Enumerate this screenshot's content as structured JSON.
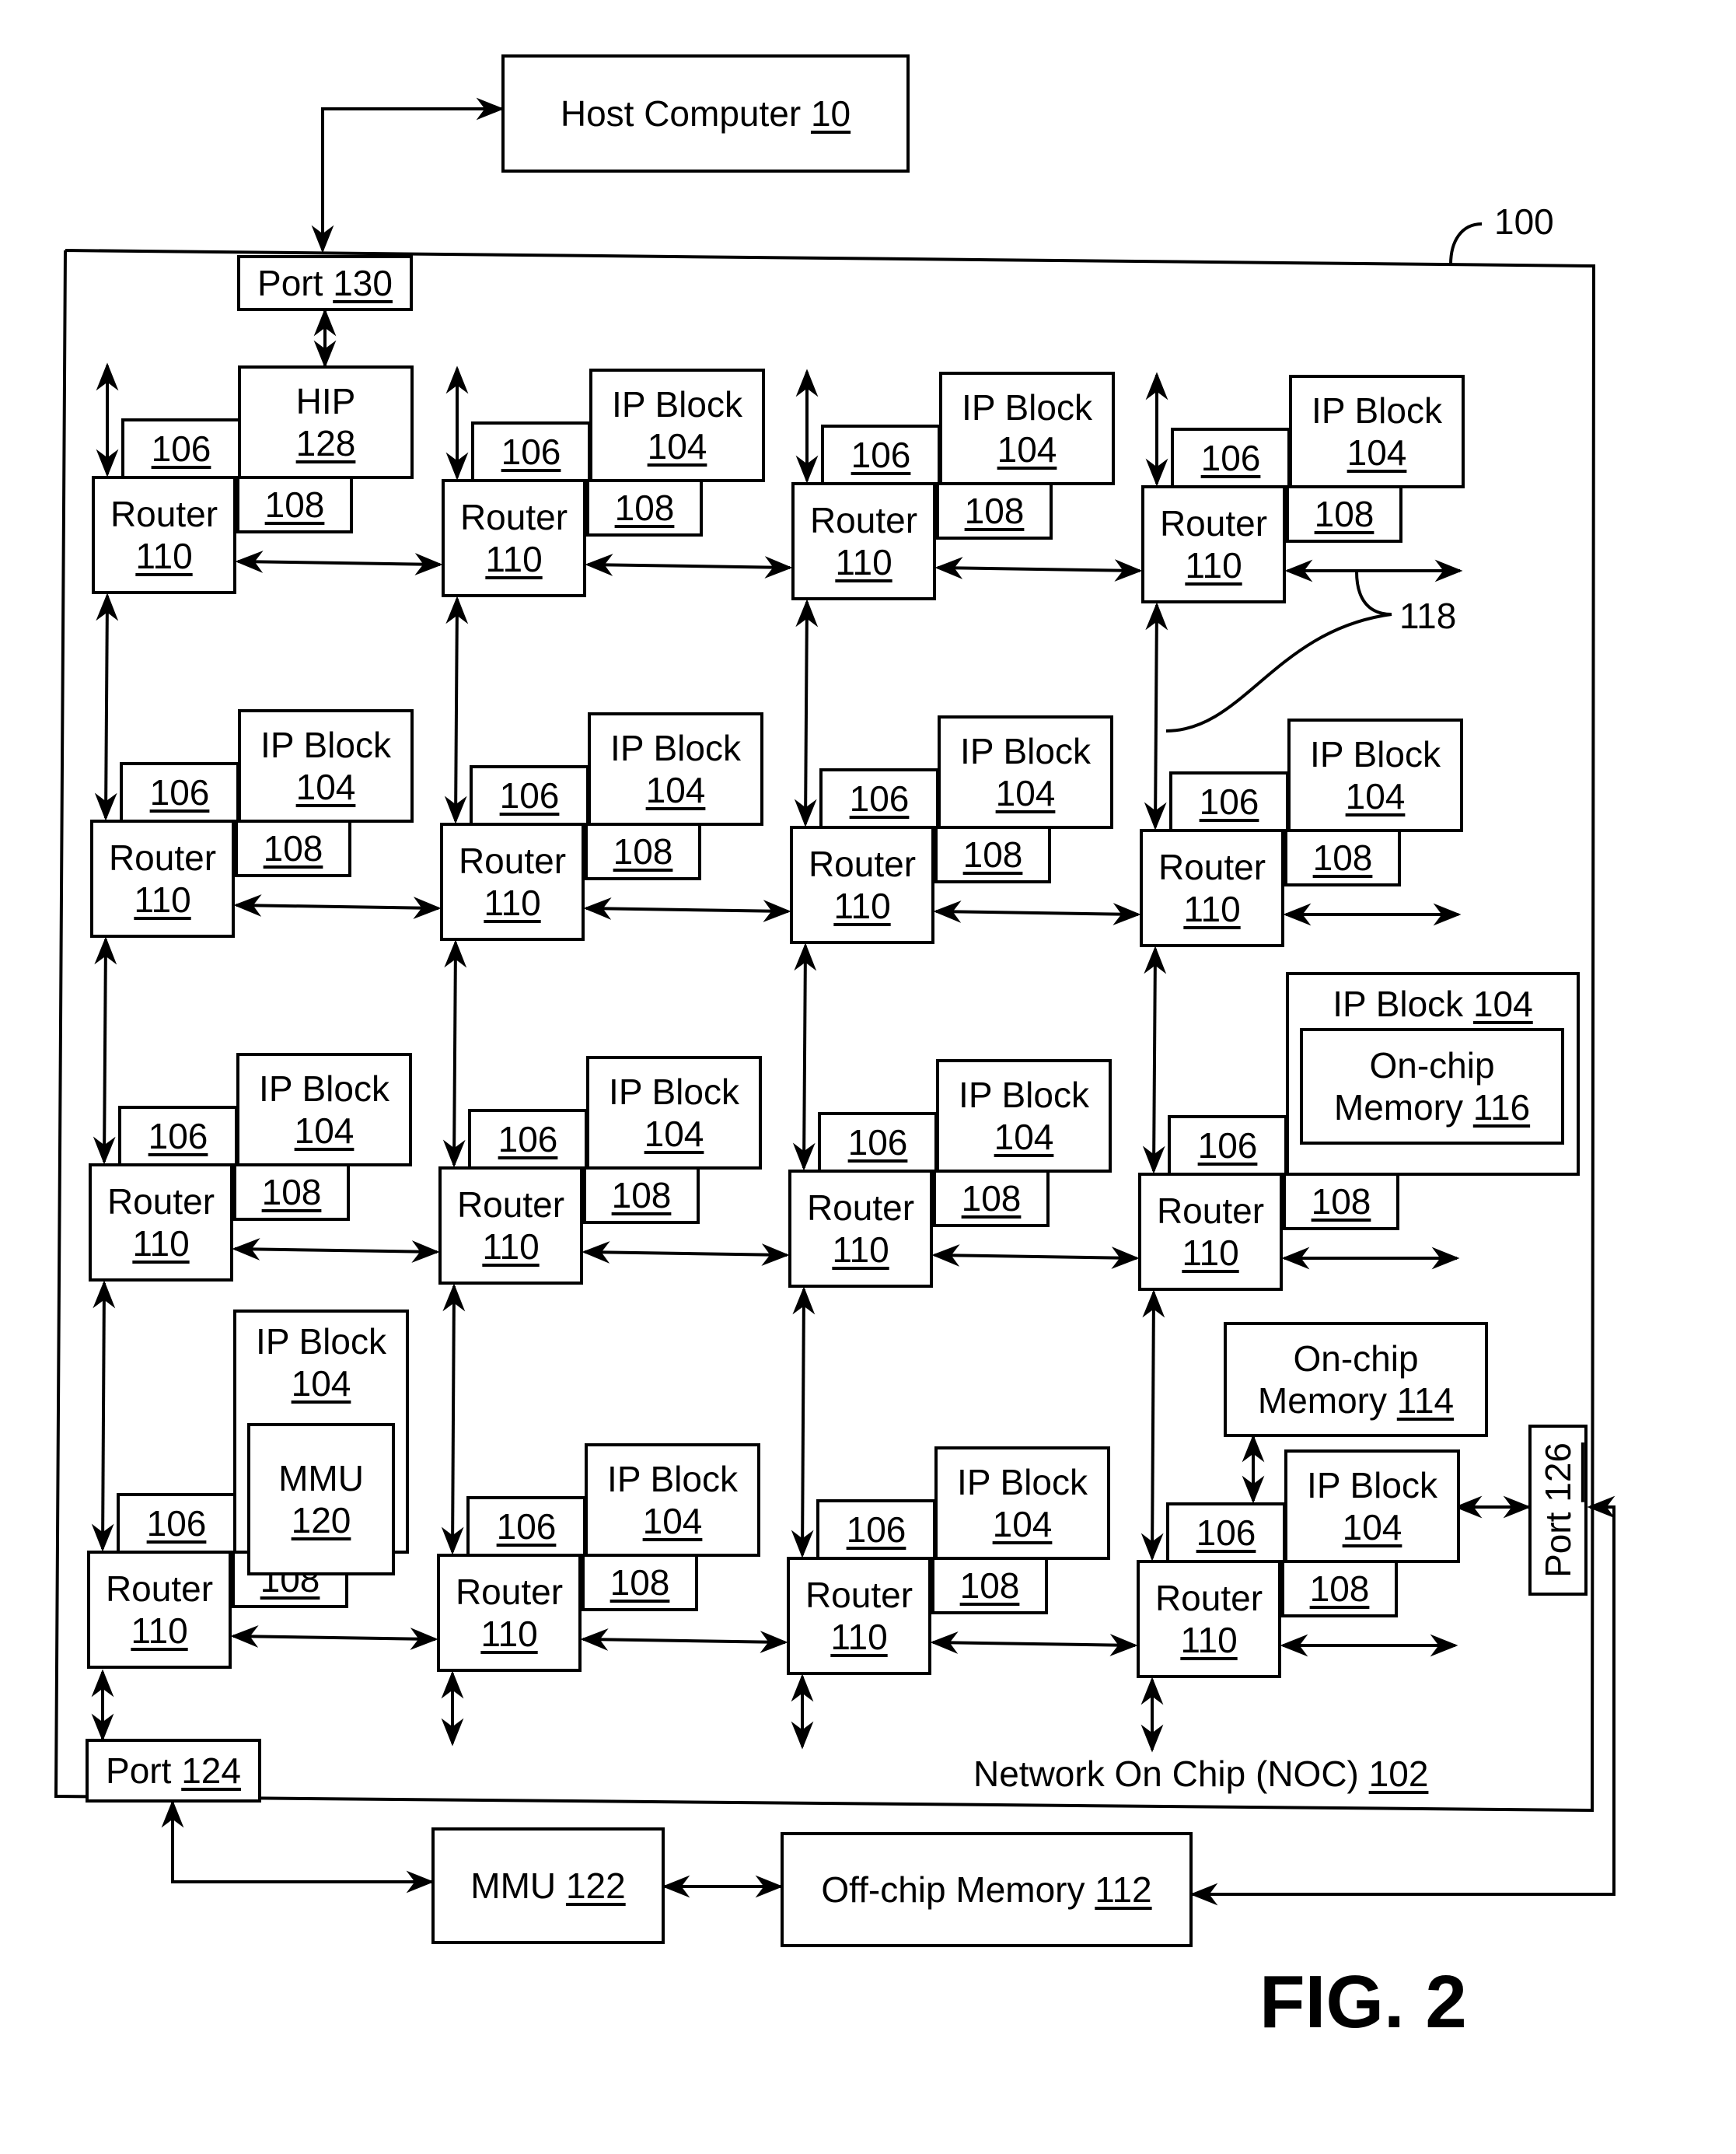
{
  "figure_label": "FIG. 2",
  "host_computer": {
    "name": "Host Computer",
    "ref": "10"
  },
  "chip": {
    "ref": "100"
  },
  "noc": {
    "name": "Network On Chip (NOC)",
    "ref": "102"
  },
  "link_ref": "118",
  "ports": {
    "p130": {
      "name": "Port",
      "ref": "130"
    },
    "p124": {
      "name": "Port",
      "ref": "124"
    },
    "p126": {
      "name": "Port",
      "ref": "126"
    }
  },
  "external": {
    "mmu": {
      "name": "MMU",
      "ref": "122"
    },
    "offchip": {
      "name": "Off-chip  Memory",
      "ref": "112"
    }
  },
  "onchip_memory_114": {
    "line1": "On-chip",
    "line2": "Memory",
    "ref": "114"
  },
  "labels": {
    "router": "Router",
    "router_ref": "110",
    "mem_ctrl_ref": "106",
    "ni_ref": "108",
    "ip_block": "IP Block",
    "ip_ref": "104",
    "hip": "HIP",
    "hip_ref": "128",
    "mmu_inner": "MMU",
    "mmu_inner_ref": "120",
    "onchip_116_line1": "On-chip",
    "onchip_116_line2": "Memory",
    "onchip_116_ref": "116"
  },
  "grid": {
    "rows": 4,
    "cols": 4,
    "special_nodes": [
      {
        "row": 0,
        "col": 0,
        "kind": "hip"
      },
      {
        "row": 2,
        "col": 3,
        "kind": "ip_with_onchip_memory_116"
      },
      {
        "row": 3,
        "col": 0,
        "kind": "ip_with_mmu_120"
      },
      {
        "row": 3,
        "col": 3,
        "kind": "ip_with_onchip_memory_114_and_port_126"
      }
    ]
  }
}
